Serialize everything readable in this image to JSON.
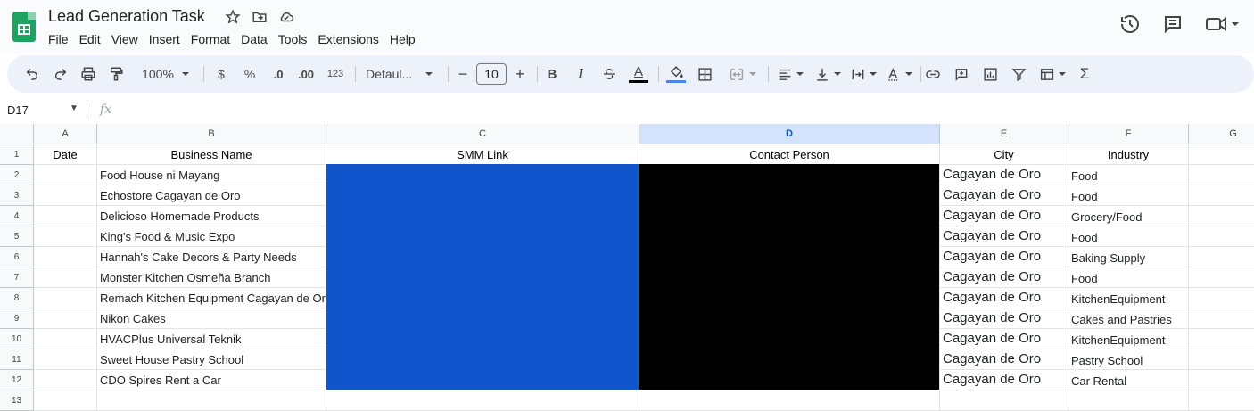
{
  "app": {
    "title": "Lead Generation Task",
    "menu": [
      "File",
      "Edit",
      "View",
      "Insert",
      "Format",
      "Data",
      "Tools",
      "Extensions",
      "Help"
    ]
  },
  "toolbar": {
    "zoom": "100%",
    "currency": "$",
    "percent": "%",
    "dec_decrease": ".0",
    "dec_increase": ".00",
    "number_format": "123",
    "font": "Defaul...",
    "font_size": "10",
    "minus": "−",
    "plus": "+",
    "bold": "B",
    "italic": "I",
    "text_color_glyph": "A",
    "sigma": "Σ"
  },
  "formula_bar": {
    "cell_ref": "D17",
    "fx": "fx"
  },
  "columns": [
    "A",
    "B",
    "C",
    "D",
    "E",
    "F",
    "G"
  ],
  "selected_column": "D",
  "rows": [
    "1",
    "2",
    "3",
    "4",
    "5",
    "6",
    "7",
    "8",
    "9",
    "10",
    "11",
    "12",
    "13"
  ],
  "header_row": [
    "Date",
    "Business Name",
    "SMM Link",
    "Contact Person",
    "City",
    "Industry"
  ],
  "records": [
    {
      "business": "Food House ni Mayang",
      "city": "Cagayan de Oro",
      "industry": "Food"
    },
    {
      "business": "Echostore Cagayan de Oro",
      "city": "Cagayan de Oro",
      "industry": "Food"
    },
    {
      "business": "Delicioso Homemade Products",
      "city": "Cagayan de Oro",
      "industry": "Grocery/Food"
    },
    {
      "business": "King's Food & Music Expo",
      "city": "Cagayan de Oro",
      "industry": "Food"
    },
    {
      "business": "Hannah's Cake Decors & Party Needs",
      "city": "Cagayan de Oro",
      "industry": "Baking Supply"
    },
    {
      "business": "Monster Kitchen Osmeña Branch",
      "city": "Cagayan de Oro",
      "industry": "Food"
    },
    {
      "business": "Remach Kitchen Equipment Cagayan de Oro",
      "city": "Cagayan de Oro",
      "industry": "KitchenEquipment"
    },
    {
      "business": "Nikon Cakes",
      "city": "Cagayan de Oro",
      "industry": "Cakes and Pastries"
    },
    {
      "business": "HVACPlus Universal Teknik",
      "city": "Cagayan de Oro",
      "industry": "KitchenEquipment"
    },
    {
      "business": "Sweet House Pastry School",
      "city": "Cagayan de Oro",
      "industry": "Pastry School"
    },
    {
      "business": "CDO Spires Rent a Car",
      "city": "Cagayan de Oro",
      "industry": "Car Rental"
    }
  ],
  "colors": {
    "redaction_blue": "#1155cc",
    "redaction_black": "#000000",
    "selected_header": "#d3e3fd"
  }
}
